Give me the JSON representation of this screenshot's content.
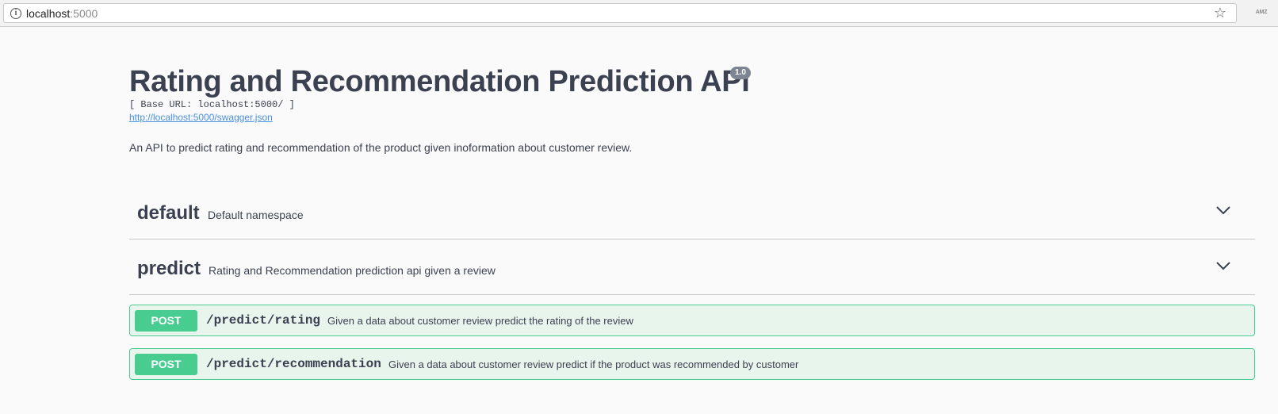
{
  "browser": {
    "url_host": "localhost",
    "url_port": ":5000",
    "extension_label": "AMZ"
  },
  "info": {
    "title": "Rating and Recommendation Prediction API",
    "version": "1.0",
    "base_url": "[ Base URL: localhost:5000/ ]",
    "spec_link": "http://localhost:5000/swagger.json",
    "description": "An API to predict rating and recommendation of the product given inoformation about customer review."
  },
  "sections": [
    {
      "name": "default",
      "description": "Default namespace"
    },
    {
      "name": "predict",
      "description": "Rating and Recommendation prediction api given a review"
    }
  ],
  "operations": [
    {
      "method": "POST",
      "path": "/predict/rating",
      "summary": "Given a data about customer review predict the rating of the review"
    },
    {
      "method": "POST",
      "path": "/predict/recommendation",
      "summary": "Given a data about customer review predict if the product was recommended by customer"
    }
  ],
  "colors": {
    "post_method": "#49cc90",
    "post_background": "#e8f5ed",
    "link": "#4990e2",
    "text": "#3b4151"
  }
}
